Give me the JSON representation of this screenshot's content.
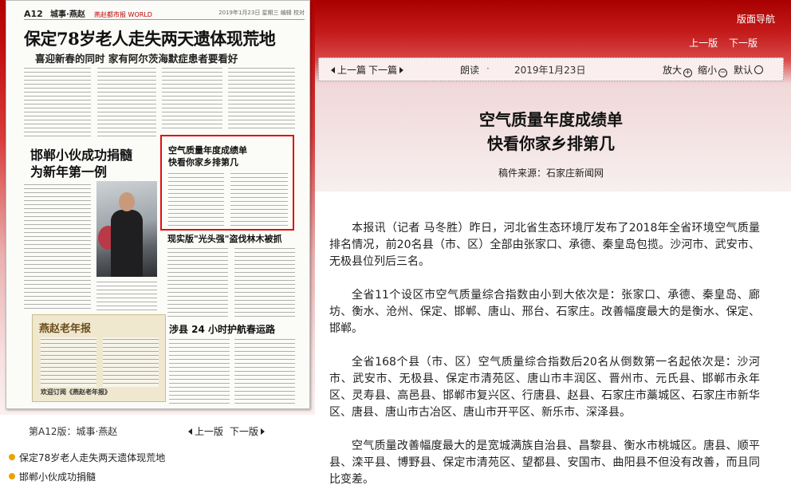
{
  "left": {
    "newspaper": {
      "page_no": "A12",
      "page_category": "城事·燕赵",
      "brand": "燕赵都市报 WORLD",
      "header_right": "2019年1月23日 星期三 编辑 校对",
      "headline_main": "保定78岁老人走失两天遗体现荒地",
      "subhead_main": "喜迎新春的同时  家有阿尔茨海默症患者要看好",
      "headline_second": "邯郸小伙成功捐髓\n为新年第一例",
      "boxed_headline": "空气质量年度成绩单\n快看你家乡排第几",
      "headline_third": "现实版\"光头强\"盗伐林木被抓",
      "headline_fourth": "涉县 24 小时护航春运路",
      "ad_title": "燕赵老年报",
      "ad_footer": "欢迎订阅《燕赵老年报》"
    },
    "page_nav": {
      "edition": "第A12版：城事·燕赵",
      "prev_label": "上一版",
      "next_label": "下一版"
    },
    "articles": [
      {
        "title": "保定78岁老人走失两天遗体现荒地"
      },
      {
        "title": "邯郸小伙成功捐髓"
      }
    ]
  },
  "right": {
    "nav_label": "版面导航",
    "prev_edition": "上一版",
    "next_edition": "下一版",
    "toolbar": {
      "prev_article": "上一篇",
      "next_article": "下一篇",
      "read": "朗读",
      "separator": "·",
      "date": "2019年1月23日",
      "zoom_in": "放大",
      "zoom_out": "缩小",
      "zoom_default": "默认"
    },
    "article": {
      "title_line1": "空气质量年度成绩单",
      "title_line2": "快看你家乡排第几",
      "source": "稿件来源：石家庄新闻网",
      "paragraphs": [
        "本报讯（记者 马冬胜）昨日，河北省生态环境厅发布了2018年全省环境空气质量排名情况，前20名县（市、区）全部由张家口、承德、秦皇岛包揽。沙河市、武安市、无极县位列后三名。",
        "全省11个设区市空气质量综合指数由小到大依次是：张家口、承德、秦皇岛、廊坊、衡水、沧州、保定、邯郸、唐山、邢台、石家庄。改善幅度最大的是衡水、保定、邯郸。",
        "全省168个县（市、区）空气质量综合指数后20名从倒数第一名起依次是：沙河市、武安市、无极县、保定市清苑区、唐山市丰润区、晋州市、元氏县、邯郸市永年区、灵寿县、高邑县、邯郸市复兴区、行唐县、赵县、石家庄市藁城区、石家庄市新华区、唐县、唐山市古冶区、唐山市开平区、新乐市、深泽县。",
        "空气质量改善幅度最大的是宽城满族自治县、昌黎县、衡水市桃城区。唐县、顺平县、滦平县、博野县、保定市清苑区、望都县、安国市、曲阳县不但没有改善，而且同比变差。"
      ]
    }
  }
}
